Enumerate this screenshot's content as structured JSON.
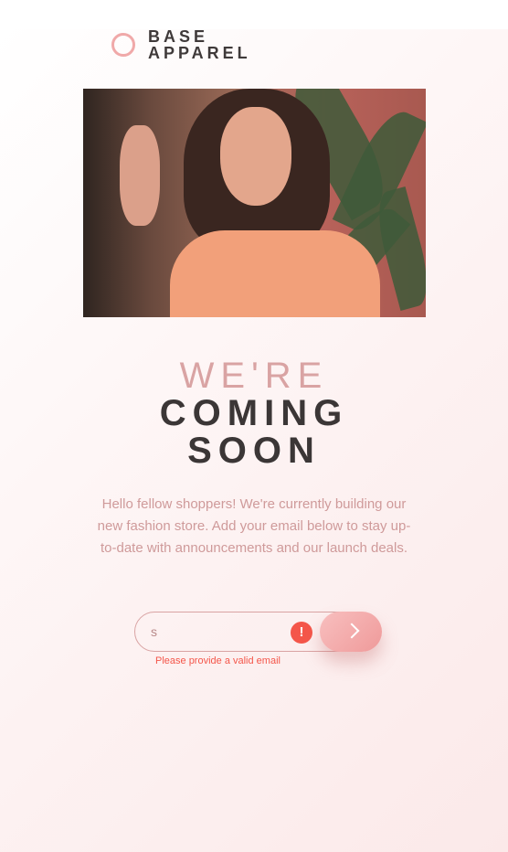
{
  "brand": {
    "line1": "BASE",
    "line2": "APPAREL",
    "accent": "#f0a9a9"
  },
  "hero": {
    "image_icon": "woman-portrait-photo"
  },
  "headline": {
    "light": "WE'RE",
    "bold_line1": "COMING",
    "bold_line2": "SOON"
  },
  "description": "Hello fellow shoppers! We're currently building our new fashion store. Add your email below to stay up-to-date with announcements and our launch deals.",
  "form": {
    "email_value": "s",
    "error_icon": "!",
    "submit_icon": "chevron-right-icon",
    "error_message": "Please provide a valid email",
    "error_color": "#f4564a"
  }
}
